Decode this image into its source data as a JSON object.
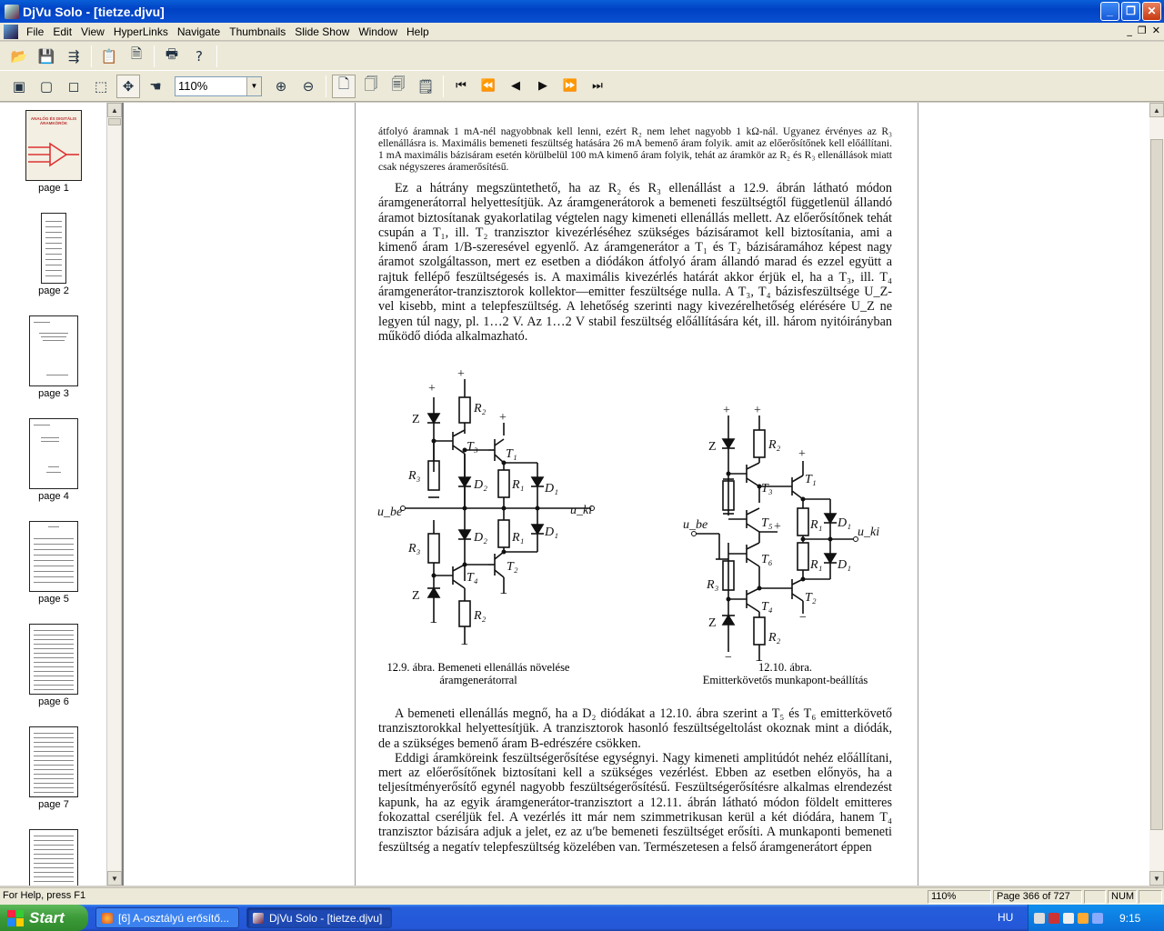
{
  "window": {
    "title": "DjVu Solo - [tietze.djvu]"
  },
  "menu": [
    "File",
    "Edit",
    "View",
    "HyperLinks",
    "Navigate",
    "Thumbnails",
    "Slide Show",
    "Window",
    "Help"
  ],
  "toolbar": {
    "zoom": "110%"
  },
  "thumbnails": [
    {
      "label": "page 1",
      "cover_title": "ANALÓG ÉS DIGITÁLIS ÁRAMKÖRÖK"
    },
    {
      "label": "page 2"
    },
    {
      "label": "page 3"
    },
    {
      "label": "page 4"
    },
    {
      "label": "page 5"
    },
    {
      "label": "page 6"
    },
    {
      "label": "page 7"
    }
  ],
  "document": {
    "small_para": "átfolyó áramnak 1 mA-nél nagyobbnak kell lenni, ezért R₂ nem lehet nagyobb 1 kΩ-nál. Ugyanez érvényes az R₃ ellenállásra is. Maximális bemeneti feszültség hatására 26 mA bemenő áram folyik. amit az előerősítőnek kell előállítani. 1 mA maximális bázisáram esetén körülbelül 100 mA kimenő áram folyik, tehát az áramkör az R₂ és R₃ ellenállások miatt csak négyszeres áramerősítésű.",
    "para1": "Ez a hátrány megszüntethető, ha az R₂ és R₃ ellenállást a 12.9. ábrán látható módon áramgenerátorral helyettesítjük. Az áramgenerátorok a bemeneti feszültségtől függetlenül állandó áramot biztosítanak gyakorlatilag végtelen nagy kimeneti ellenállás mellett. Az előerősítőnek tehát csupán a T₁, ill. T₂ tranzisztor kivezérléséhez szükséges bázisáramot kell biztosítania, ami a kimenő áram 1/B-szeresével egyenlő. Az áramgenerátor a T₁ és T₂ bázisáramához képest nagy áramot szolgáltasson, mert ez esetben a diódákon átfolyó áram állandó marad és ezzel együtt a rajtuk fellépő feszültségesés is. A maximális kivezérlés határát akkor érjük el, ha a T₃, ill. T₄ áramgenerátor-tranzisztorok kollektor—emitter feszültsége nulla. A T₃, T₄ bázisfeszültsége U_Z-vel kisebb, mint a telepfeszültség. A lehetőség szerinti nagy kivezérelhetőség elérésére U_Z ne legyen túl nagy, pl. 1…2 V. Az 1…2 V stabil feszültség előállítására két, ill. három nyitóirányban működő dióda alkalmazható.",
    "caption1a": "12.9. ábra. Bemeneti ellenállás növelése",
    "caption1b": "áramgenerátorral",
    "caption2a": "12.10. ábra.",
    "caption2b": "Emitterkövetős munkapont-beállítás",
    "para2": "A bemeneti ellenállás megnő, ha a D₂ diódákat a 12.10. ábra szerint a T₅ és T₆ emitterkövető tranzisztorokkal helyettesítjük. A tranzisztorok hasonló feszültségeltolást okoznak mint a diódák, de a szükséges bemenő áram B-edrészére csökken.",
    "para3": "Eddigi áramköreink feszültségerősítése egységnyi. Nagy kimeneti amplitúdót nehéz előállítani, mert az előerősítőnek biztosítani kell a szükséges vezérlést. Ebben az esetben előnyös, ha a teljesítményerősítő egynél nagyobb feszültségerősítésű. Feszültségerősítésre alkalmas elrendezést kapunk, ha az egyik áramgenerátor-tranzisztort a 12.11. ábrán látható módon földelt emitteres fokozattal cseréljük fel. A vezérlés itt már nem szimmetrikusan kerül a két diódára, hanem T₄ tranzisztor bázisára adjuk a jelet, ez az u′be bemeneti feszültséget erősíti. A munkaponti bemeneti feszültség a negatív telepfeszültség közelében van. Természetesen a felső áramgenerátort éppen",
    "fig1_labels": {
      "R2": "R₂",
      "R3": "R₃",
      "T3": "T₃",
      "T1": "T₁",
      "T2": "T₂",
      "T4": "T₄",
      "D1": "D₁",
      "D2": "D₂",
      "R1": "R₁",
      "Z": "Z",
      "ube": "u_be",
      "uki": "u_ki",
      "plus": "+",
      "minus": "−"
    },
    "fig2_labels": {
      "T5": "T₅",
      "T6": "T₆"
    }
  },
  "status": {
    "help": "For Help, press F1",
    "zoom": "110%",
    "page": "Page 366 of 727",
    "num": "NUM"
  },
  "taskbar": {
    "start": "Start",
    "task1": "[6] A-osztályú erősítő...",
    "task2": "DjVu Solo - [tietze.djvu]",
    "lang": "HU",
    "clock": "9:15"
  }
}
